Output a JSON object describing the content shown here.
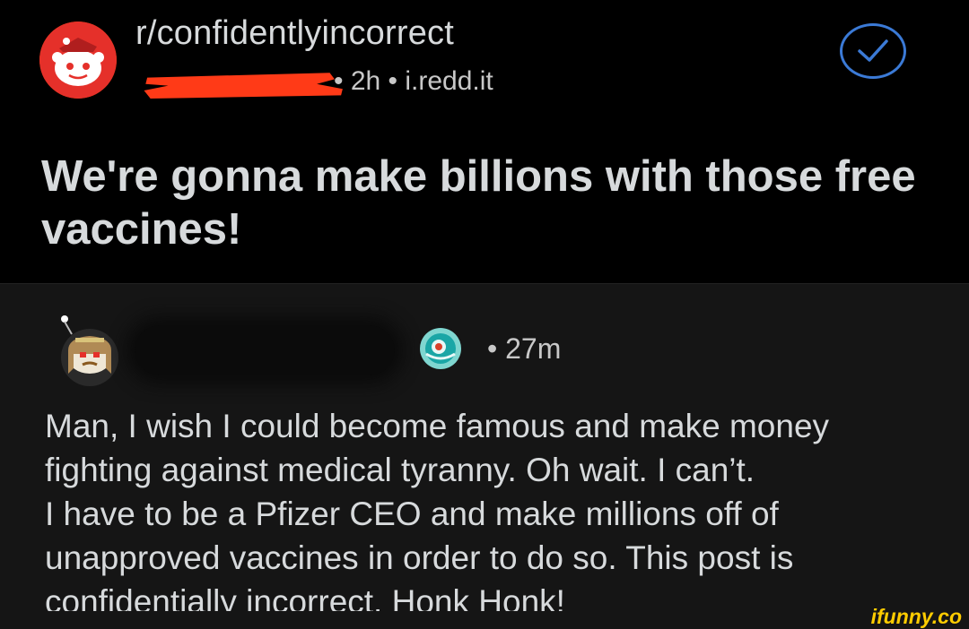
{
  "post": {
    "subreddit": "r/confidentlyincorrect",
    "meta": "• 2h • i.redd.it",
    "title": "We're gonna make billions with those free vaccines!",
    "accent_color": "#ff4500",
    "verified_icon": "checkmark-circle-icon"
  },
  "comment": {
    "time": "• 27m",
    "award_icon": "award-icon",
    "body": "Man, I wish I could become famous and make money\nfighting against medical tyranny. Oh wait. I can’t.\nI have to be a Pfizer CEO and make millions off of\nunapproved vaccines in order to do so. This post is\nconfidentially incorrect. Honk Honk!"
  },
  "watermark": "ifunny.co"
}
